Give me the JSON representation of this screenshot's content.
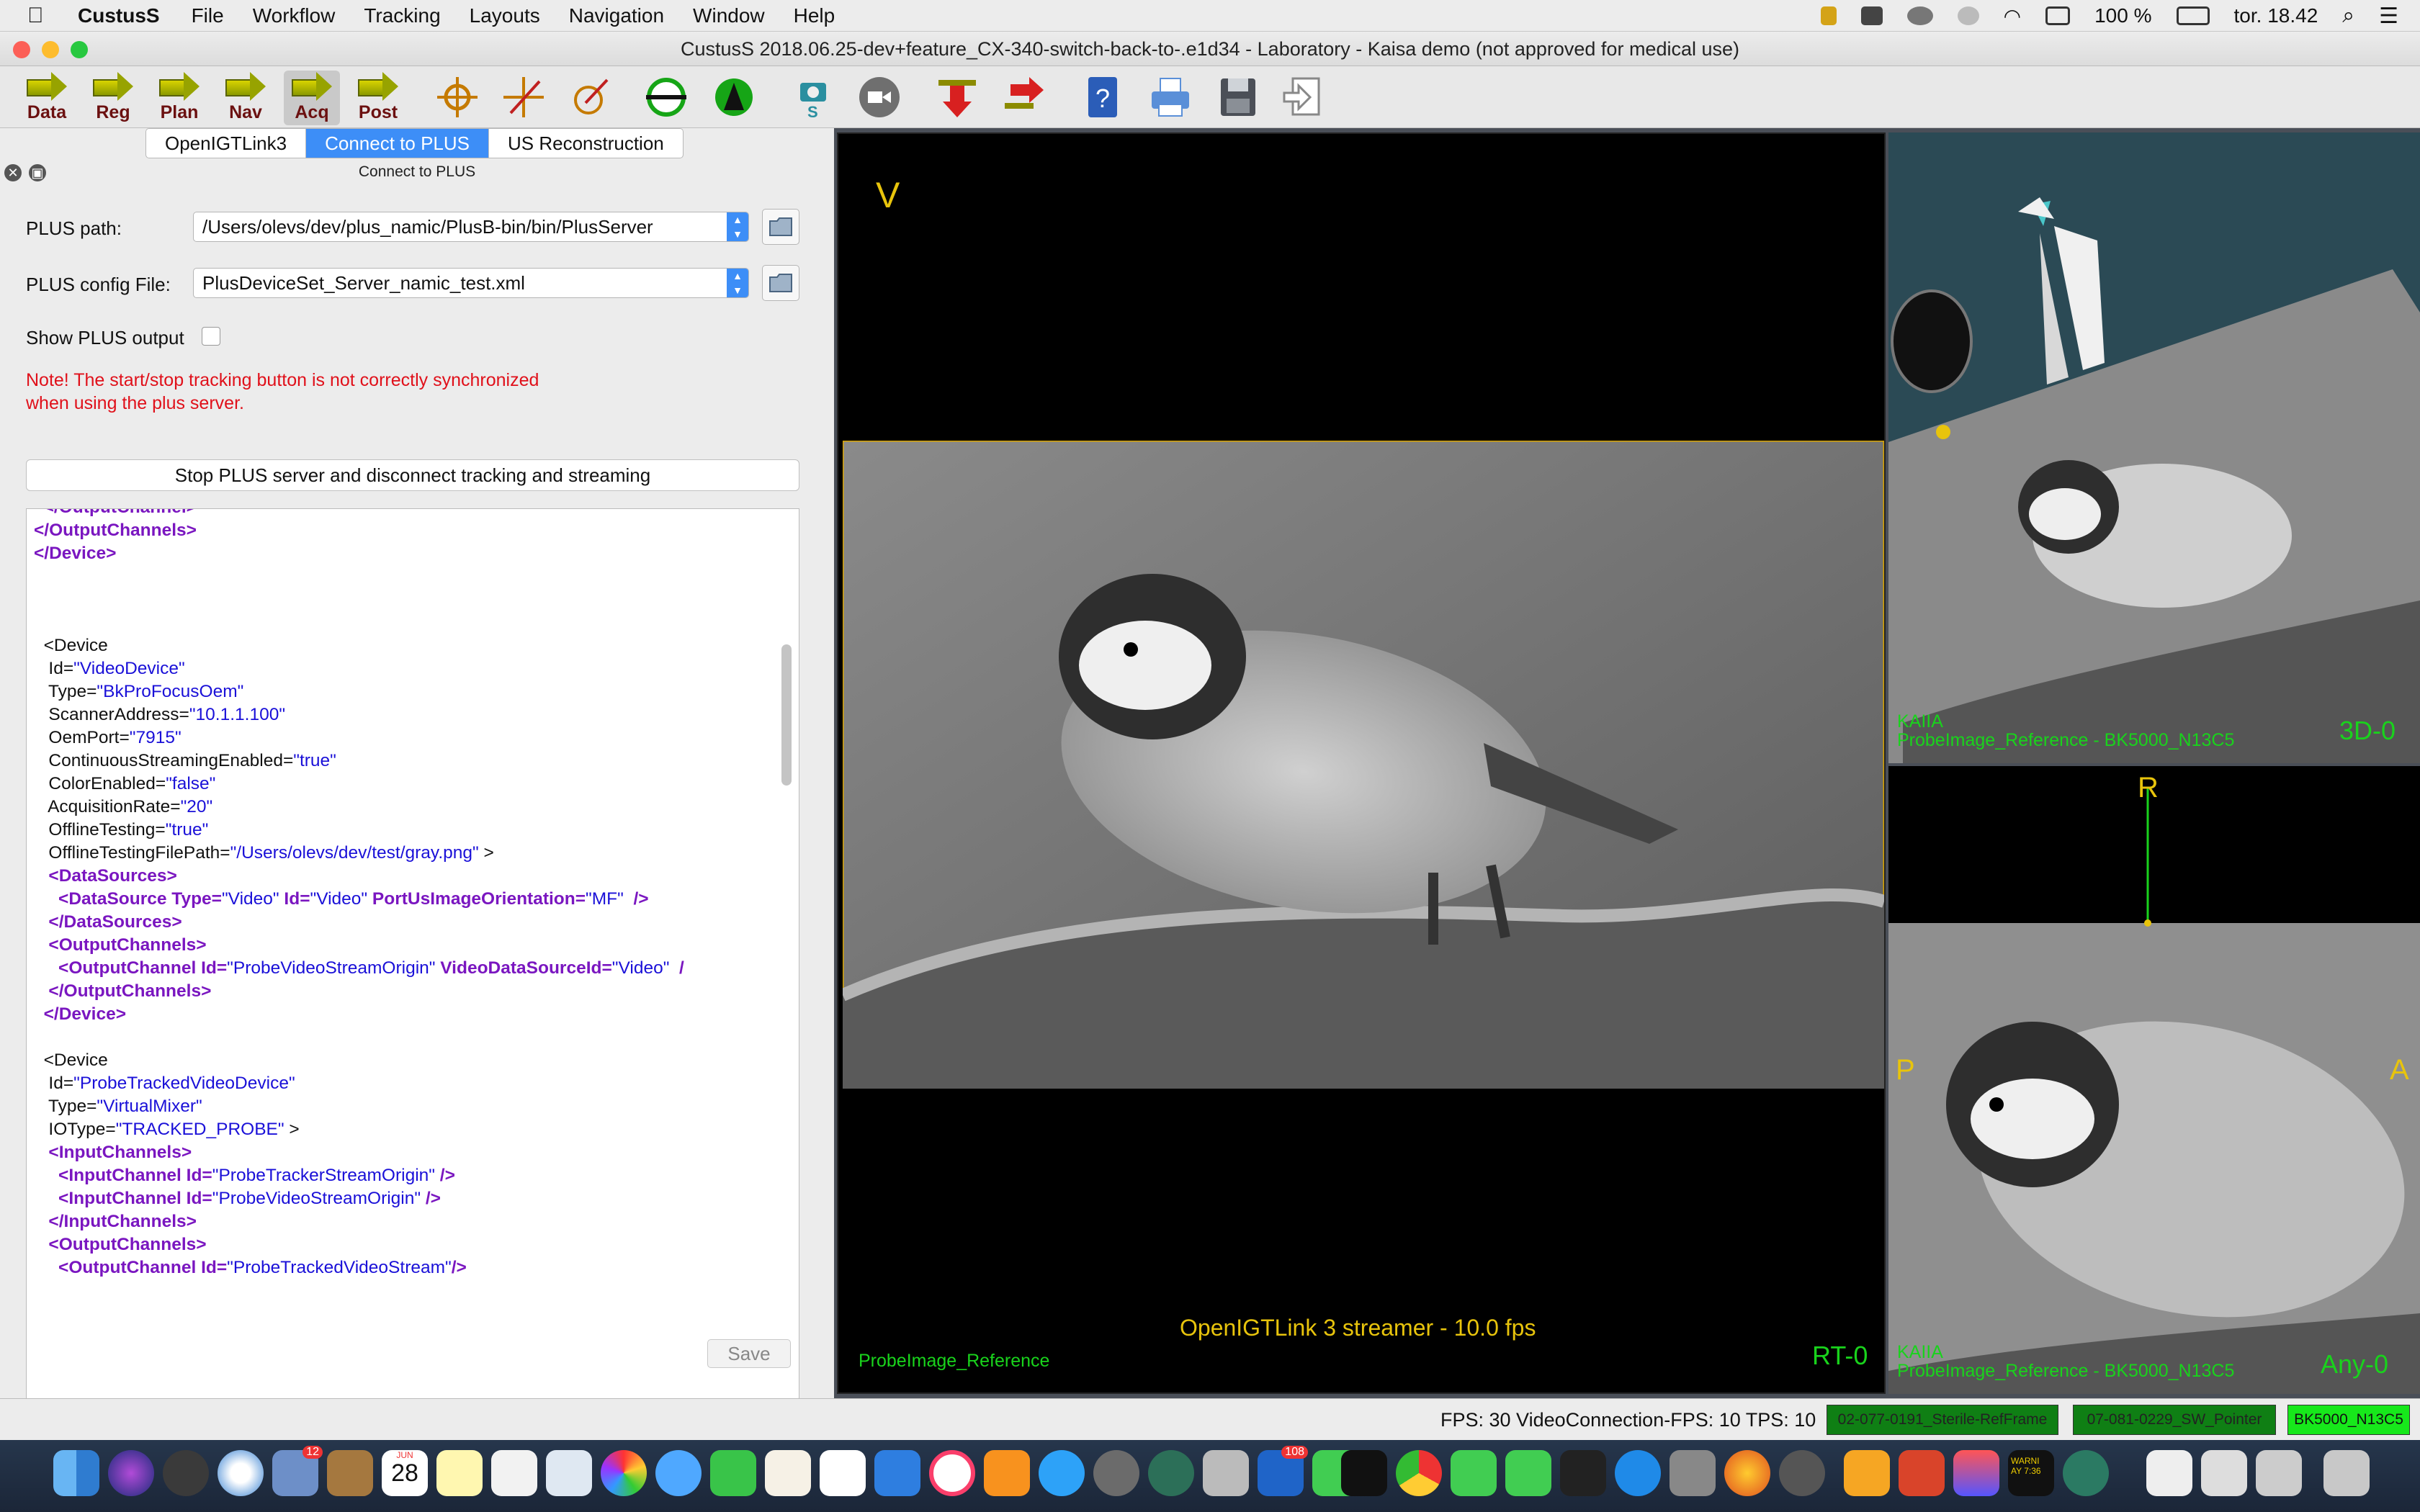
{
  "menubar": {
    "app_name": "CustusS",
    "items": [
      "File",
      "Workflow",
      "Tracking",
      "Layouts",
      "Navigation",
      "Window",
      "Help"
    ],
    "battery": "100 %",
    "clock": "tor. 18.42"
  },
  "window": {
    "title": "CustusS 2018.06.25-dev+feature_CX-340-switch-back-to-.e1d34 - Laboratory - Kaisa demo  (not approved for medical use)"
  },
  "toolbar": {
    "workflow_steps": [
      "Data",
      "Reg",
      "Plan",
      "Nav",
      "Acq",
      "Post"
    ],
    "active_step": "Acq",
    "snapshot_label": "S"
  },
  "tabs": [
    "OpenIGTLink3",
    "Connect to PLUS",
    "US Reconstruction"
  ],
  "panel": {
    "title": "Connect to PLUS",
    "plus_path_label": "PLUS path:",
    "plus_path_value": "/Users/olevs/dev/plus_namic/PlusB-bin/bin/PlusServer",
    "plus_config_label": "PLUS config File:",
    "plus_config_value": "PlusDeviceSet_Server_namic_test.xml",
    "show_output_label": "Show PLUS output",
    "note_line1": "Note! The start/stop tracking button is not correctly synchronized",
    "note_line2": "when using the plus server.",
    "stop_button": "Stop PLUS server and disconnect tracking and streaming",
    "save_button": "Save"
  },
  "xml_lines": [
    [
      {
        "t": "  </OutputChannel>",
        "c": "tag"
      }
    ],
    [
      {
        "t": "</OutputChannels>",
        "c": "tag"
      }
    ],
    [
      {
        "t": "</Device>",
        "c": "tag"
      }
    ],
    [
      {
        "t": "",
        "c": "plain"
      }
    ],
    [
      {
        "t": "",
        "c": "plain"
      }
    ],
    [
      {
        "t": "",
        "c": "plain"
      }
    ],
    [
      {
        "t": "  <Device",
        "c": "plain"
      }
    ],
    [
      {
        "t": "   Id=",
        "c": "plain"
      },
      {
        "t": "\"VideoDevice\"",
        "c": "val"
      }
    ],
    [
      {
        "t": "   Type=",
        "c": "plain"
      },
      {
        "t": "\"BkProFocusOem\"",
        "c": "val"
      }
    ],
    [
      {
        "t": "   ScannerAddress=",
        "c": "plain"
      },
      {
        "t": "\"10.1.1.100\"",
        "c": "val"
      }
    ],
    [
      {
        "t": "   OemPort=",
        "c": "plain"
      },
      {
        "t": "\"7915\"",
        "c": "val"
      }
    ],
    [
      {
        "t": "   ContinuousStreamingEnabled=",
        "c": "plain"
      },
      {
        "t": "\"true\"",
        "c": "val"
      }
    ],
    [
      {
        "t": "   ColorEnabled=",
        "c": "plain"
      },
      {
        "t": "\"false\"",
        "c": "val"
      }
    ],
    [
      {
        "t": "   AcquisitionRate=",
        "c": "plain"
      },
      {
        "t": "\"20\"",
        "c": "val"
      }
    ],
    [
      {
        "t": "   OfflineTesting=",
        "c": "plain"
      },
      {
        "t": "\"true\"",
        "c": "val"
      }
    ],
    [
      {
        "t": "   OfflineTestingFilePath=",
        "c": "plain"
      },
      {
        "t": "\"/Users/olevs/dev/test/gray.png\"",
        "c": "val"
      },
      {
        "t": " >",
        "c": "plain"
      }
    ],
    [
      {
        "t": "   <DataSources>",
        "c": "tag"
      }
    ],
    [
      {
        "t": "     <DataSource Type=",
        "c": "tag"
      },
      {
        "t": "\"Video\"",
        "c": "val"
      },
      {
        "t": " Id=",
        "c": "tag"
      },
      {
        "t": "\"Video\"",
        "c": "val"
      },
      {
        "t": " PortUsImageOrientation=",
        "c": "tag"
      },
      {
        "t": "\"MF\"",
        "c": "val"
      },
      {
        "t": "  />",
        "c": "tag"
      }
    ],
    [
      {
        "t": "   </DataSources>",
        "c": "tag"
      }
    ],
    [
      {
        "t": "   <OutputChannels>",
        "c": "tag"
      }
    ],
    [
      {
        "t": "     <OutputChannel Id=",
        "c": "tag"
      },
      {
        "t": "\"ProbeVideoStreamOrigin\"",
        "c": "val"
      },
      {
        "t": " VideoDataSourceId=",
        "c": "tag"
      },
      {
        "t": "\"Video\"",
        "c": "val"
      },
      {
        "t": "  /",
        "c": "tag"
      }
    ],
    [
      {
        "t": "   </OutputChannels>",
        "c": "tag"
      }
    ],
    [
      {
        "t": "  </Device>",
        "c": "tag"
      }
    ],
    [
      {
        "t": "",
        "c": "plain"
      }
    ],
    [
      {
        "t": "  <Device",
        "c": "plain"
      }
    ],
    [
      {
        "t": "   Id=",
        "c": "plain"
      },
      {
        "t": "\"ProbeTrackedVideoDevice\"",
        "c": "val"
      }
    ],
    [
      {
        "t": "   Type=",
        "c": "plain"
      },
      {
        "t": "\"VirtualMixer\"",
        "c": "val"
      }
    ],
    [
      {
        "t": "   IOType=",
        "c": "plain"
      },
      {
        "t": "\"TRACKED_PROBE\"",
        "c": "val"
      },
      {
        "t": " >",
        "c": "plain"
      }
    ],
    [
      {
        "t": "   <InputChannels>",
        "c": "tag"
      }
    ],
    [
      {
        "t": "     <InputChannel Id=",
        "c": "tag"
      },
      {
        "t": "\"ProbeTrackerStreamOrigin\"",
        "c": "val"
      },
      {
        "t": " />",
        "c": "tag"
      }
    ],
    [
      {
        "t": "     <InputChannel Id=",
        "c": "tag"
      },
      {
        "t": "\"ProbeVideoStreamOrigin\"",
        "c": "val"
      },
      {
        "t": " />",
        "c": "tag"
      }
    ],
    [
      {
        "t": "   </InputChannels>",
        "c": "tag"
      }
    ],
    [
      {
        "t": "   <OutputChannels>",
        "c": "tag"
      }
    ],
    [
      {
        "t": "     <OutputChannel Id=",
        "c": "tag"
      },
      {
        "t": "\"ProbeTrackedVideoStream\"",
        "c": "val"
      },
      {
        "t": "/>",
        "c": "tag"
      }
    ]
  ],
  "views": {
    "rt": {
      "orientation": "V",
      "streamer_text": "OpenIGTLink 3 streamer - 10.0 fps",
      "image_name": "ProbeImage_Reference",
      "view_name": "RT-0"
    },
    "threed": {
      "patient": "KAIIA",
      "image_info": "ProbeImage_Reference - BK5000_N13C5",
      "view_name": "3D-0"
    },
    "any": {
      "top_label": "R",
      "left_label": "P",
      "right_label": "A",
      "patient": "KAIIA",
      "image_info": "ProbeImage_Reference - BK5000_N13C5",
      "view_name": "Any-0"
    }
  },
  "statusbar": {
    "fps_text": "FPS: 30  VideoConnection-FPS: 10  TPS: 10",
    "tools": [
      "02-077-0191_Sterile-RefFrame",
      "07-081-0229_SW_Pointer",
      "BK5000_N13C5"
    ]
  },
  "dock": {
    "calendar_month": "JUN",
    "calendar_day": "28",
    "badge_count_1": "12",
    "badge_count_2": "108",
    "console_text": "WARNI\nAY 7:36"
  },
  "colors": {
    "accent_blue": "#3d8ef7",
    "orientation_yellow": "#e8c40c",
    "overlay_green": "#19d31c",
    "note_red": "#e0101a",
    "tool_green_dark": "#0f7f14",
    "tool_green_bright": "#17e81b"
  }
}
